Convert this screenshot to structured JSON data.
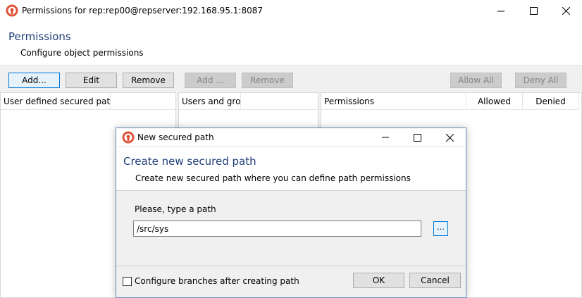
{
  "window": {
    "title": "Permissions for rep:rep00@repserver:192.168.95.1:8087",
    "heading": "Permissions",
    "subheading": "Configure object permissions",
    "icons": {
      "app": "plastic-scm-logo-icon",
      "minimize": "minimize-icon",
      "maximize": "maximize-icon",
      "close": "close-icon"
    }
  },
  "toolbar": {
    "add_label": "Add...",
    "edit_label": "Edit",
    "remove_label": "Remove",
    "add2_label": "Add ...",
    "remove2_label": "Remove",
    "allow_all_label": "Allow All",
    "deny_all_label": "Deny All"
  },
  "panels": {
    "paths_header": "User defined secured paths",
    "users_header": "Users and gro...",
    "permissions_headers": [
      "Permissions",
      "Allowed",
      "Denied"
    ]
  },
  "dialog": {
    "title": "New secured path",
    "heading": "Create new secured path",
    "subheading": "Create new secured path where you can define path permissions",
    "path_label": "Please, type a path",
    "path_value": "/src/sys",
    "browse_label": "...",
    "checkbox_label": "Configure branches after creating path",
    "checkbox_checked": false,
    "ok_label": "OK",
    "cancel_label": "Cancel"
  },
  "colors": {
    "accent": "#0078d7",
    "heading_blue": "#1f3d7a",
    "logo_red": "#e0523a",
    "dialog_border": "#6b8cc1"
  }
}
